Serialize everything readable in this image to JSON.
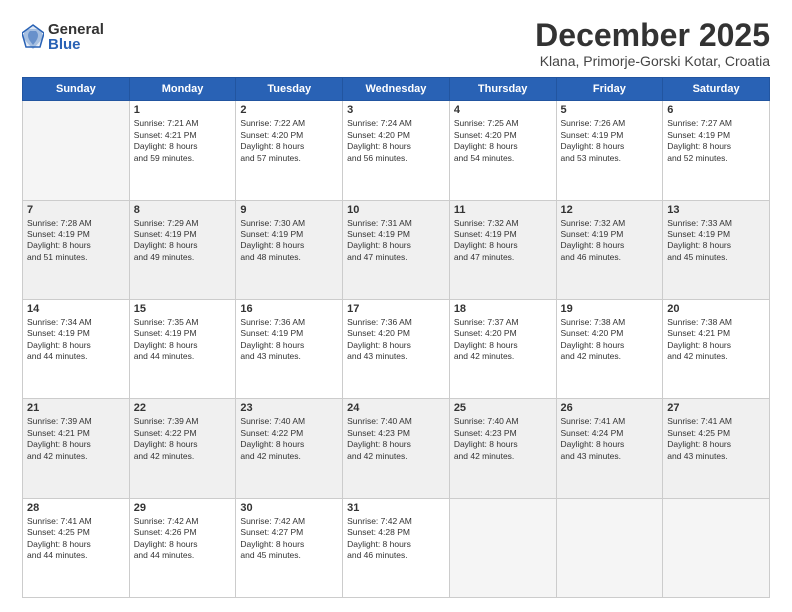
{
  "logo": {
    "general": "General",
    "blue": "Blue"
  },
  "title": "December 2025",
  "location": "Klana, Primorje-Gorski Kotar, Croatia",
  "days_of_week": [
    "Sunday",
    "Monday",
    "Tuesday",
    "Wednesday",
    "Thursday",
    "Friday",
    "Saturday"
  ],
  "weeks": [
    [
      {
        "day": "",
        "info": ""
      },
      {
        "day": "1",
        "info": "Sunrise: 7:21 AM\nSunset: 4:21 PM\nDaylight: 8 hours\nand 59 minutes."
      },
      {
        "day": "2",
        "info": "Sunrise: 7:22 AM\nSunset: 4:20 PM\nDaylight: 8 hours\nand 57 minutes."
      },
      {
        "day": "3",
        "info": "Sunrise: 7:24 AM\nSunset: 4:20 PM\nDaylight: 8 hours\nand 56 minutes."
      },
      {
        "day": "4",
        "info": "Sunrise: 7:25 AM\nSunset: 4:20 PM\nDaylight: 8 hours\nand 54 minutes."
      },
      {
        "day": "5",
        "info": "Sunrise: 7:26 AM\nSunset: 4:19 PM\nDaylight: 8 hours\nand 53 minutes."
      },
      {
        "day": "6",
        "info": "Sunrise: 7:27 AM\nSunset: 4:19 PM\nDaylight: 8 hours\nand 52 minutes."
      }
    ],
    [
      {
        "day": "7",
        "info": "Sunrise: 7:28 AM\nSunset: 4:19 PM\nDaylight: 8 hours\nand 51 minutes."
      },
      {
        "day": "8",
        "info": "Sunrise: 7:29 AM\nSunset: 4:19 PM\nDaylight: 8 hours\nand 49 minutes."
      },
      {
        "day": "9",
        "info": "Sunrise: 7:30 AM\nSunset: 4:19 PM\nDaylight: 8 hours\nand 48 minutes."
      },
      {
        "day": "10",
        "info": "Sunrise: 7:31 AM\nSunset: 4:19 PM\nDaylight: 8 hours\nand 47 minutes."
      },
      {
        "day": "11",
        "info": "Sunrise: 7:32 AM\nSunset: 4:19 PM\nDaylight: 8 hours\nand 47 minutes."
      },
      {
        "day": "12",
        "info": "Sunrise: 7:32 AM\nSunset: 4:19 PM\nDaylight: 8 hours\nand 46 minutes."
      },
      {
        "day": "13",
        "info": "Sunrise: 7:33 AM\nSunset: 4:19 PM\nDaylight: 8 hours\nand 45 minutes."
      }
    ],
    [
      {
        "day": "14",
        "info": "Sunrise: 7:34 AM\nSunset: 4:19 PM\nDaylight: 8 hours\nand 44 minutes."
      },
      {
        "day": "15",
        "info": "Sunrise: 7:35 AM\nSunset: 4:19 PM\nDaylight: 8 hours\nand 44 minutes."
      },
      {
        "day": "16",
        "info": "Sunrise: 7:36 AM\nSunset: 4:19 PM\nDaylight: 8 hours\nand 43 minutes."
      },
      {
        "day": "17",
        "info": "Sunrise: 7:36 AM\nSunset: 4:20 PM\nDaylight: 8 hours\nand 43 minutes."
      },
      {
        "day": "18",
        "info": "Sunrise: 7:37 AM\nSunset: 4:20 PM\nDaylight: 8 hours\nand 42 minutes."
      },
      {
        "day": "19",
        "info": "Sunrise: 7:38 AM\nSunset: 4:20 PM\nDaylight: 8 hours\nand 42 minutes."
      },
      {
        "day": "20",
        "info": "Sunrise: 7:38 AM\nSunset: 4:21 PM\nDaylight: 8 hours\nand 42 minutes."
      }
    ],
    [
      {
        "day": "21",
        "info": "Sunrise: 7:39 AM\nSunset: 4:21 PM\nDaylight: 8 hours\nand 42 minutes."
      },
      {
        "day": "22",
        "info": "Sunrise: 7:39 AM\nSunset: 4:22 PM\nDaylight: 8 hours\nand 42 minutes."
      },
      {
        "day": "23",
        "info": "Sunrise: 7:40 AM\nSunset: 4:22 PM\nDaylight: 8 hours\nand 42 minutes."
      },
      {
        "day": "24",
        "info": "Sunrise: 7:40 AM\nSunset: 4:23 PM\nDaylight: 8 hours\nand 42 minutes."
      },
      {
        "day": "25",
        "info": "Sunrise: 7:40 AM\nSunset: 4:23 PM\nDaylight: 8 hours\nand 42 minutes."
      },
      {
        "day": "26",
        "info": "Sunrise: 7:41 AM\nSunset: 4:24 PM\nDaylight: 8 hours\nand 43 minutes."
      },
      {
        "day": "27",
        "info": "Sunrise: 7:41 AM\nSunset: 4:25 PM\nDaylight: 8 hours\nand 43 minutes."
      }
    ],
    [
      {
        "day": "28",
        "info": "Sunrise: 7:41 AM\nSunset: 4:25 PM\nDaylight: 8 hours\nand 44 minutes."
      },
      {
        "day": "29",
        "info": "Sunrise: 7:42 AM\nSunset: 4:26 PM\nDaylight: 8 hours\nand 44 minutes."
      },
      {
        "day": "30",
        "info": "Sunrise: 7:42 AM\nSunset: 4:27 PM\nDaylight: 8 hours\nand 45 minutes."
      },
      {
        "day": "31",
        "info": "Sunrise: 7:42 AM\nSunset: 4:28 PM\nDaylight: 8 hours\nand 46 minutes."
      },
      {
        "day": "",
        "info": ""
      },
      {
        "day": "",
        "info": ""
      },
      {
        "day": "",
        "info": ""
      }
    ]
  ]
}
